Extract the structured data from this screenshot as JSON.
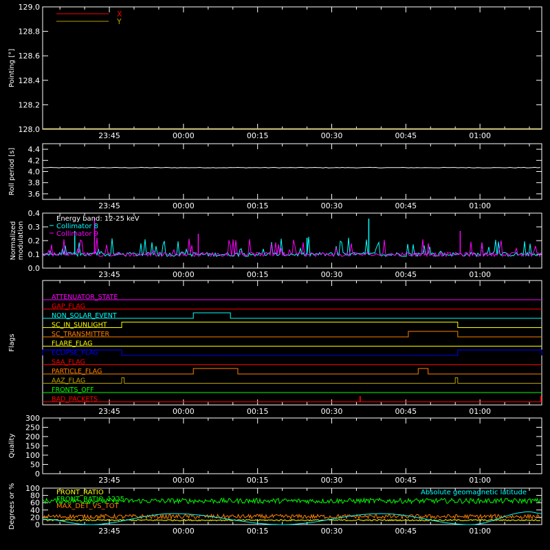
{
  "x_ticks": [
    "23:45",
    "00:00",
    "00:15",
    "00:30",
    "00:45",
    "01:00"
  ],
  "x_tick_minutes": [
    -15,
    0,
    15,
    30,
    45,
    60
  ],
  "x_range_minutes": [
    -28.5,
    72.5
  ],
  "colors": {
    "axes": "#ffffff",
    "x_series": "#ff0000",
    "y_series": "#b8a000",
    "collimator8": "#00ffff",
    "collimator9": "#ff00ff",
    "legend_white": "#ffffff",
    "front_ratio": "#ffff00",
    "front_ratio_1225": "#00ff00",
    "max_det": "#ff8000",
    "geomag": "#00ffff"
  },
  "chart_data": [
    {
      "type": "line",
      "ylabel": "Pointing [°]",
      "ylim": [
        128.0,
        129.0
      ],
      "yticks": [
        "128.0",
        "128.2",
        "128.4",
        "128.6",
        "128.8",
        "129.0"
      ],
      "yvals": [
        128.0,
        128.2,
        128.4,
        128.6,
        128.8,
        129.0
      ],
      "legend": [
        {
          "name": "X",
          "color": "#ff0000"
        },
        {
          "name": "Y",
          "color": "#b8a000"
        }
      ],
      "series": [
        {
          "name": "X",
          "values": []
        },
        {
          "name": "Y",
          "values": [
            128.0,
            128.0
          ]
        }
      ]
    },
    {
      "type": "line",
      "ylabel": "Roll period [s]",
      "ylim": [
        3.5,
        4.5
      ],
      "yticks": [
        "3.6",
        "3.8",
        "4.0",
        "4.2",
        "4.4"
      ],
      "yvals": [
        3.6,
        3.8,
        4.0,
        4.2,
        4.4
      ],
      "series": [
        {
          "name": "",
          "value_approx": 4.07
        }
      ]
    },
    {
      "type": "line",
      "ylabel": [
        "Normalized",
        "modulation"
      ],
      "ylim": [
        0.0,
        0.4
      ],
      "yticks": [
        "0.0",
        "0.1",
        "0.2",
        "0.3",
        "0.4"
      ],
      "yvals": [
        0.0,
        0.1,
        0.2,
        0.3,
        0.4
      ],
      "legend": [
        {
          "name": "Energy band: 12-25 keV",
          "color": "#ffffff"
        },
        {
          "name": "Collimator 8",
          "color": "#00ffff"
        },
        {
          "name": "Collimator 9",
          "color": "#ff00ff"
        }
      ],
      "series": [
        {
          "name": "Collimator 8",
          "baseline": 0.1,
          "spikes": [
            [
              37.5,
              0.36
            ],
            [
              25,
              0.22
            ],
            [
              -22,
              0.27
            ]
          ]
        },
        {
          "name": "Collimator 9",
          "baseline": 0.1,
          "spikes": [
            [
              -18,
              0.37
            ],
            [
              56,
              0.27
            ],
            [
              3,
              0.25
            ]
          ]
        }
      ]
    },
    {
      "type": "line",
      "ylabel": "Flags",
      "flags": [
        {
          "name": "ATTENUATOR_STATE",
          "color": "#ff00ff",
          "high": []
        },
        {
          "name": "GAP_FLAG",
          "color": "#ff0000",
          "high": []
        },
        {
          "name": "NON_SOLAR_EVENT",
          "color": "#00ffff",
          "high": [
            [
              2,
              9.5
            ]
          ]
        },
        {
          "name": "SC_IN_SUNLIGHT",
          "color": "#ffff00",
          "high": [
            [
              -12.5,
              55.5
            ]
          ]
        },
        {
          "name": "SC_TRANSMITTER",
          "color": "#ff8000",
          "high": [
            [
              45.5,
              55.5
            ]
          ]
        },
        {
          "name": "FLARE_FLAG",
          "color": "#ffff00",
          "high": []
        },
        {
          "name": "ECLIPSE_FLAG",
          "color": "#0000ff",
          "high": [
            [
              -28.5,
              -12.5
            ],
            [
              55.5,
              72.5
            ]
          ]
        },
        {
          "name": "SAA_FLAG",
          "color": "#ff0000",
          "high": []
        },
        {
          "name": "PARTICLE_FLAG",
          "color": "#ff8000",
          "high": [
            [
              2,
              11
            ],
            [
              47.5,
              49.5
            ]
          ]
        },
        {
          "name": "AAZ_FLAG",
          "color": "#b8a000",
          "high": [
            [
              -12.5,
              -12
            ],
            [
              55,
              55.5
            ]
          ]
        },
        {
          "name": "FRONTS_OFF",
          "color": "#00ff00",
          "high": []
        },
        {
          "name": "BAD_PACKETS",
          "color": "#ff0000",
          "high": [
            [
              35.7,
              35.8
            ],
            [
              72.3,
              72.4
            ]
          ]
        }
      ]
    },
    {
      "type": "line",
      "ylabel": "Quality",
      "ylim": [
        0,
        300
      ],
      "yticks": [
        "0",
        "50",
        "100",
        "150",
        "200",
        "250",
        "300"
      ],
      "yvals": [
        0,
        50,
        100,
        150,
        200,
        250,
        300
      ],
      "series": [
        {
          "name": "",
          "values": []
        }
      ]
    },
    {
      "type": "line",
      "ylabel": "Degrees or %",
      "ylim": [
        0,
        100
      ],
      "yticks": [
        "0",
        "20",
        "40",
        "60",
        "80",
        "100"
      ],
      "yvals": [
        0,
        20,
        40,
        60,
        80,
        100
      ],
      "legend": [
        {
          "name": "FRONT_RATIO",
          "color": "#ffff00"
        },
        {
          "name": "FRONT_RATIO_1225",
          "color": "#00ff00"
        },
        {
          "name": "MAX_DET_VS_TOT",
          "color": "#ff8000"
        }
      ],
      "legend_right": {
        "name": "Absolute geomagnetic latitude",
        "color": "#00ffff"
      },
      "series": [
        {
          "name": "FRONT_RATIO_1225",
          "mean": 65
        },
        {
          "name": "MAX_DET_VS_TOT",
          "mean": 22
        },
        {
          "name": "FRONT_RATIO",
          "mean": 12
        },
        {
          "name": "Absolute geomagnetic latitude",
          "peaks": [
            [
              -2,
              30
            ],
            [
              40,
              30
            ],
            [
              70,
              35
            ]
          ],
          "troughs": [
            [
              -19,
              0
            ],
            [
              20,
              0
            ],
            [
              58,
              0
            ]
          ]
        }
      ]
    }
  ]
}
